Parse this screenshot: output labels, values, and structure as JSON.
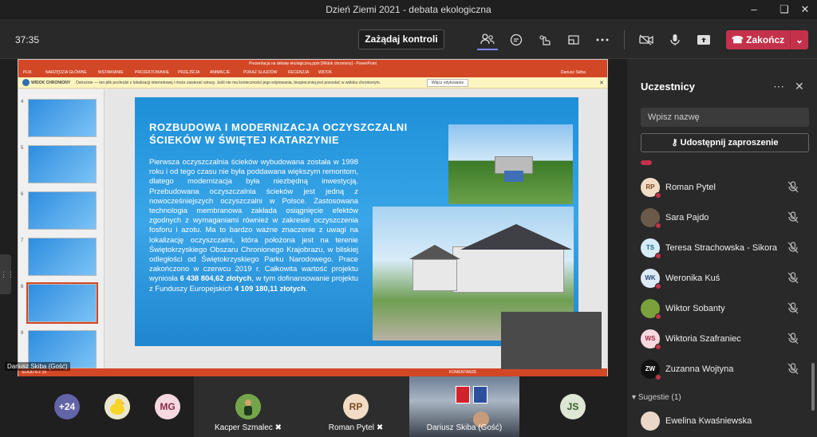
{
  "window": {
    "title": "Dzień Ziemi 2021 - debata ekologiczna"
  },
  "toolbar": {
    "timer": "37:35",
    "control_label": "Zażądaj kontroli",
    "leave_label": "Zakończ"
  },
  "ppt": {
    "title": "Prezentacja na debatę ekologiczną.pptx [Widok chroniony] - PowerPoint",
    "user": "Dariusz Skiba",
    "tabs": [
      "PLIK",
      "NARZĘDZIA GŁÓWNE",
      "WSTAWIANIE",
      "PROJEKTOWANIE",
      "PRZEJŚCIA",
      "ANIMACJE",
      "POKAZ SLAJDÓW",
      "RECENZJA",
      "WIDOK"
    ],
    "protected_label": "WIDOK CHRONIONY",
    "protected_text": "Ostrożnie — ten plik pochodzi z lokalizacji internetowej i może zawierać wirusy. Jeśli nie ma konieczności jego edytowania, bezpieczniej jest pozostać w widoku chronionym.",
    "protected_button": "Włącz edytowanie",
    "thumb_numbers": [
      "4",
      "5",
      "6",
      "7",
      "8",
      "9"
    ],
    "status_left": "SLAJD 8 Z 15",
    "status_right": "KOMENTARZE"
  },
  "slide": {
    "heading": "ROZBUDOWA I MODERNIZACJA OCZYSZCZALNI ŚCIEKÓW W ŚWIĘTEJ KATARZYNIE",
    "body_lead": "Pierwsza oczyszczalnia ścieków wybudowana została w 1998 roku i od tego czasu nie była poddawana większym remontom, dlatego modernizacja była niezbędną inwestycją. Przebudowana oczyszczalnia ścieków jest jedną z nowocześniejszych oczyszczalni w Polsce. Zastosowana technologia membranowa zakłada osiągnięcie efektów zgodnych z wymaganiami również w zakresie oczyszczenia fosforu i azotu. Ma to bardzo ważne znaczenie z uwagi na lokalizację oczyszczalni, która położona jest na terenie Świętokrzyskiego Obszaru Chronionego Krajobrazu, w bliskiej odległości od Świętokrzyskiego Parku Narodowego. Prace zakończono w czerwcu 2019 r. Całkowita wartość projektu wyniosła ",
    "amount_total": "6 438 804,62 złotych",
    "body_mid": ", w tym dofinansowanie projektu z Funduszy Europejskich ",
    "amount_eu": "4 109 180,11 złotych",
    "body_end": "."
  },
  "stage_name": "Dariusz Skiba (Gość)",
  "bottom": {
    "overflow_count": "+24",
    "avatars": [
      "MG",
      "JS"
    ],
    "tiles": [
      {
        "name": "Kacper Szmalec"
      },
      {
        "name": "Roman Pytel",
        "initials": "RP"
      },
      {
        "name": "Dariusz Skiba (Gość)"
      }
    ]
  },
  "panel": {
    "title": "Uczestnicy",
    "search_placeholder": "Wpisz nazwę",
    "share_label": "Udostępnij zaproszenie",
    "participants": [
      {
        "initials": "RP",
        "name": "Roman Pytel",
        "color": "#f2dcc6",
        "fg": "#7a4a1e"
      },
      {
        "initials": "",
        "name": "Sara Pajdo",
        "color": "#6b5a4a",
        "fg": "#fff"
      },
      {
        "initials": "TS",
        "name": "Teresa Strachowska - Sikora",
        "color": "#d6ecf7",
        "fg": "#1d6a8f"
      },
      {
        "initials": "WK",
        "name": "Weronika Kuś",
        "color": "#ddeaf7",
        "fg": "#2a4f79"
      },
      {
        "initials": "",
        "name": "Wiktor Sobanty",
        "color": "#7aa13c",
        "fg": "#fff"
      },
      {
        "initials": "WS",
        "name": "Wiktoria Szafraniec",
        "color": "#f7d9df",
        "fg": "#a02a44"
      },
      {
        "initials": "ZW",
        "name": "Zuzanna Wojtyna",
        "color": "#111111",
        "fg": "#fff"
      }
    ],
    "suggestions_label": "Sugestie (1)",
    "suggestion": {
      "name": "Ewelina Kwaśniewska"
    }
  }
}
